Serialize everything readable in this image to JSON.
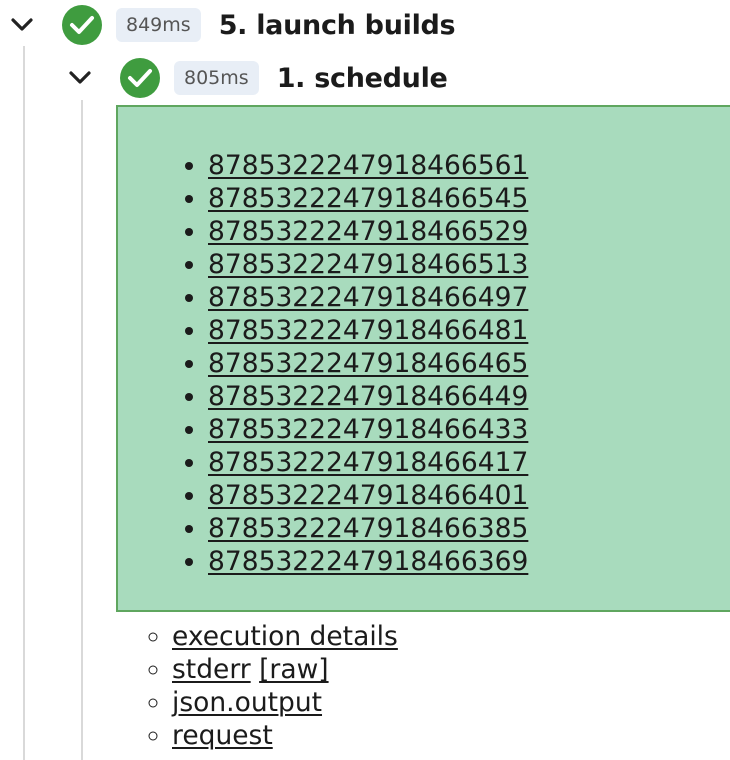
{
  "step": {
    "duration": "849ms",
    "title": "5. launch builds",
    "status": "success",
    "status_color": "#3f9c3f",
    "substep": {
      "duration": "805ms",
      "title": "1. schedule",
      "status": "success",
      "background_color": "#a8dbbd",
      "builds": [
        "8785322247918466561",
        "8785322247918466545",
        "8785322247918466529",
        "8785322247918466513",
        "8785322247918466497",
        "8785322247918466481",
        "8785322247918466465",
        "8785322247918466449",
        "8785322247918466433",
        "8785322247918466417",
        "8785322247918466401",
        "8785322247918466385",
        "8785322247918466369"
      ],
      "links": {
        "execution_details": "execution details",
        "stderr": "stderr",
        "stderr_raw": "[raw]",
        "json_output": "json.output",
        "request": "request"
      }
    }
  },
  "icons": {
    "expand": "chevron-down-icon",
    "status": "check-circle-icon"
  }
}
